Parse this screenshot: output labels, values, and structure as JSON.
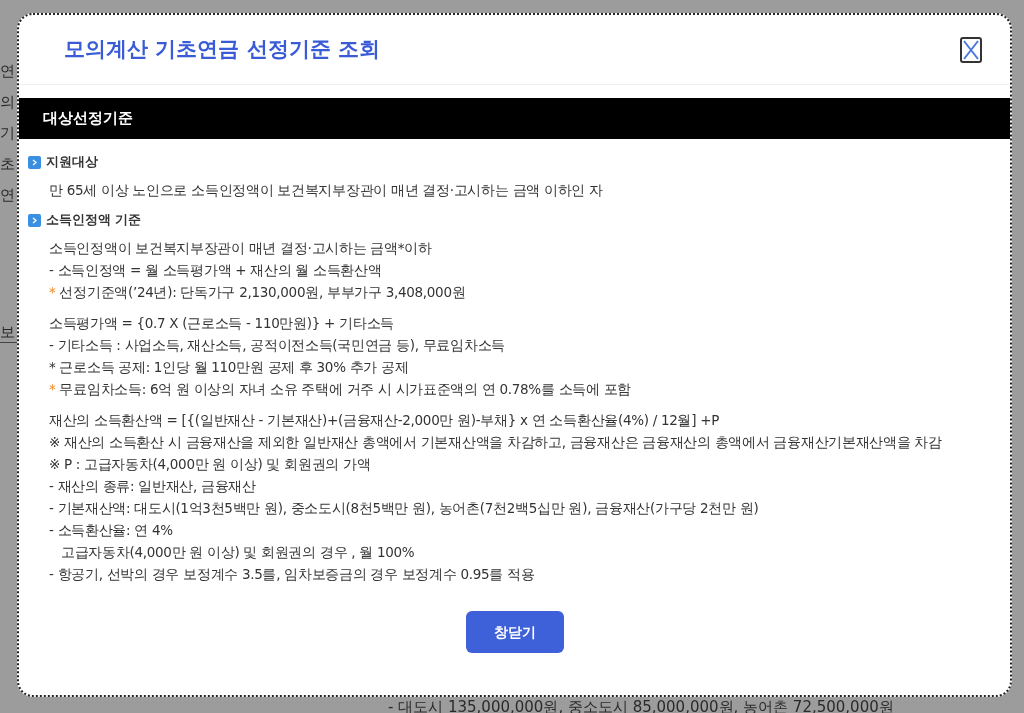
{
  "background": {
    "side_fragments": [
      "연",
      "의",
      "기",
      "초",
      "연"
    ],
    "tab_fragment": "보",
    "bottom_text": "- 대도시 135,000,000원, 중소도시 85,000,000원, 농어촌 72,500,000원"
  },
  "dialog": {
    "title": "모의계산 기초연금 선정기준 조회",
    "section_header": "대상선정기준",
    "sections": [
      {
        "heading": "지원대상",
        "groups": [
          [
            {
              "kind": "plain",
              "text": "만 65세 이상 노인으로 소득인정액이 보건복지부장관이 매년 결정·고시하는 금액 이하인 자"
            }
          ]
        ]
      },
      {
        "heading": "소득인정액 기준",
        "groups": [
          [
            {
              "kind": "plain",
              "text": "소득인정액이 보건복지부장관이 매년 결정·고시하는 금액*이하"
            },
            {
              "kind": "plain",
              "text": "- 소득인정액 = 월 소득평가액 + 재산의 월 소득환산액"
            },
            {
              "kind": "note",
              "mark": "*",
              "text": "선정기준액(’24년): 단독가구 2,130,000원, 부부가구 3,408,000원"
            }
          ],
          [
            {
              "kind": "plain",
              "text": "소득평가액 = {0.7 X (근로소득 - 110만원)} + 기타소득"
            },
            {
              "kind": "plain",
              "text": "- 기타소득 : 사업소득, 재산소득, 공적이전소득(국민연금 등), 무료임차소득"
            },
            {
              "kind": "plain",
              "text": "* 근로소득 공제: 1인당 월 110만원 공제 후 30% 추가 공제"
            },
            {
              "kind": "note",
              "mark": "*",
              "text": "무료임차소득: 6억 원 이상의 자녀 소유 주택에 거주 시 시가표준액의 연 0.78%를 소득에 포함"
            }
          ],
          [
            {
              "kind": "plain",
              "text": "재산의 소득환산액 = [{(일반재산 - 기본재산)+(금융재산-2,000만 원)-부채} x 연 소득환산율(4%) / 12월] +P"
            },
            {
              "kind": "plain",
              "text": "※ 재산의 소득환산 시 금융재산을 제외한 일반재산 총액에서 기본재산액을 차감하고, 금융재산은 금융재산의 총액에서 금융재산기본재산액을 차감"
            },
            {
              "kind": "plain",
              "text": "※ P : 고급자동차(4,000만 원 이상) 및 회원권의 가액"
            },
            {
              "kind": "plain",
              "text": "- 재산의 종류: 일반재산, 금융재산"
            },
            {
              "kind": "plain",
              "text": "- 기본재산액: 대도시(1억3천5백만 원), 중소도시(8천5백만 원), 농어촌(7천2백5십만 원), 금융재산(가구당 2천만 원)"
            },
            {
              "kind": "plain",
              "text": "- 소득환산율: 연 4%"
            },
            {
              "kind": "indent",
              "text": "고급자동차(4,000만 원 이상) 및 회원권의 경우 , 월 100%"
            },
            {
              "kind": "plain",
              "text": "- 항공기, 선박의 경우 보정계수 3.5를, 임차보증금의 경우 보정계수 0.95를 적용"
            }
          ]
        ]
      }
    ],
    "close_button": "창닫기"
  }
}
